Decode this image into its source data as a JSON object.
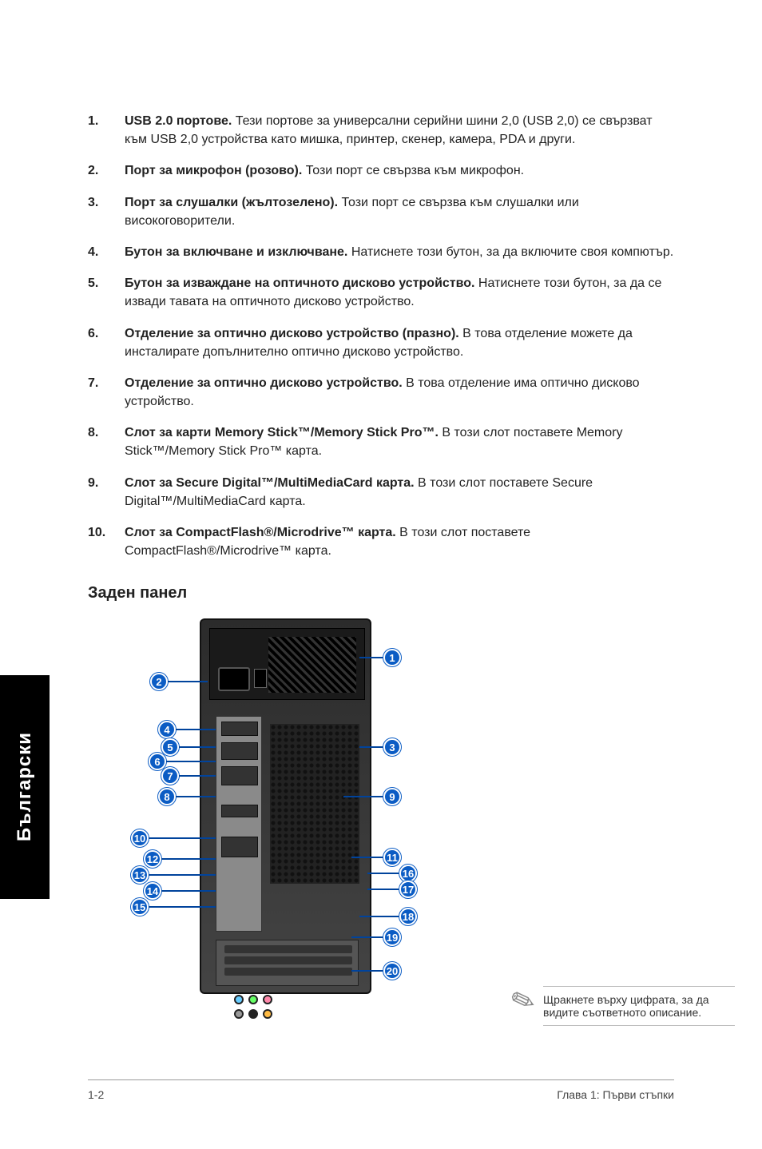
{
  "front_list": [
    {
      "num": "1.",
      "title": "USB 2.0 портове.",
      "body": " Тези портове за универсални серийни шини 2,0 (USB 2,0) се свързват към USB 2,0 устройства като мишка, принтер, скенер, камера, PDA и други."
    },
    {
      "num": "2.",
      "title": "Порт за микрофон (розово).",
      "body": " Този порт се свързва към микрофон."
    },
    {
      "num": "3.",
      "title": "Порт за слушалки (жълтозелено).",
      "body": " Този порт се свързва към слушалки или високоговорители."
    },
    {
      "num": "4.",
      "title": "Бутон за включване и изключване.",
      "body": " Натиснете този бутон, за да включите своя компютър."
    },
    {
      "num": "5.",
      "title": "Бутон за изваждане на оптичното дисково устройство.",
      "body": " Натиснете този бутон, за да се извади тавата на оптичното дисково устройство."
    },
    {
      "num": "6.",
      "title": "Отделение за оптично дисково устройство (празно).",
      "body": " В това отделение можете да инсталирате допълнително оптично дисково устройство."
    },
    {
      "num": "7.",
      "title": "Отделение за оптично дисково устройство.",
      "body": " В това отделение има оптично дисково устройство."
    },
    {
      "num": "8.",
      "title": "Слот за карти Memory Stick™/Memory Stick Pro™.",
      "body": " В този слот поставете Memory Stick™/Memory Stick Pro™ карта."
    },
    {
      "num": "9.",
      "title": "Слот за Secure Digital™/MultiMediaCard карта.",
      "body": " В този слот поставете Secure Digital™/MultiMediaCard карта."
    },
    {
      "num": "10.",
      "title": "Слот за CompactFlash®/Microdrive™ карта.",
      "body": " В този слот поставете CompactFlash®/Microdrive™ карта."
    }
  ],
  "section_heading": {
    "bold": "Заден",
    "rest": " панел"
  },
  "callouts": [
    "1",
    "2",
    "3",
    "4",
    "5",
    "6",
    "7",
    "8",
    "9",
    "10",
    "11",
    "12",
    "13",
    "14",
    "15",
    "16",
    "17",
    "18",
    "19",
    "20"
  ],
  "note": "Щракнете върху цифрата, за да видите съответното описание.",
  "side_tab": "Български",
  "footer": {
    "left": "1-2",
    "right": "Глава 1: Първи стъпки"
  }
}
